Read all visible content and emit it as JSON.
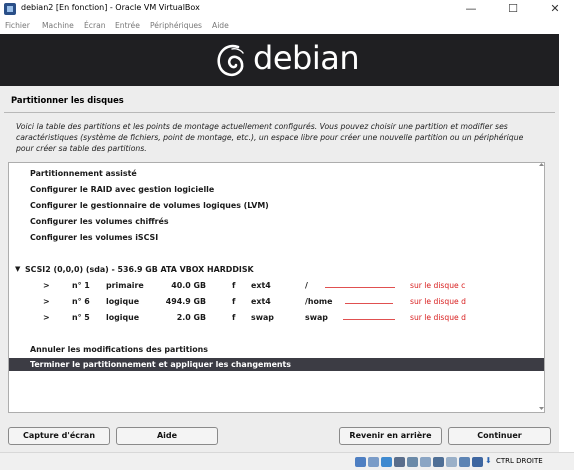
{
  "window": {
    "title": "debian2 [En fonction] - Oracle VM VirtualBox",
    "minimize_glyph": "—",
    "maximize_glyph": "☐",
    "close_glyph": "✕"
  },
  "menubar": [
    "Fichier",
    "Machine",
    "Écran",
    "Entrée",
    "Périphériques",
    "Aide"
  ],
  "banner": {
    "brand": "debian"
  },
  "installer": {
    "step_title": "Partitionner les disques",
    "description": "Voici la table des partitions et les points de montage actuellement configurés. Vous pouvez choisir une partition et modifier ses caractéristiques (système de fichiers, point de montage, etc.), un espace libre pour créer une nouvelle partition ou un périphérique pour créer sa table des partitions.",
    "menu_items": [
      "Partitionnement assisté",
      "Configurer le RAID avec gestion logicielle",
      "Configurer le gestionnaire de volumes logiques (LVM)",
      "Configurer les volumes chiffrés",
      "Configurer les volumes iSCSI"
    ],
    "disk": {
      "caret": "▼",
      "label": "SCSI2 (0,0,0) (sda) - 536.9 GB ATA VBOX HARDDISK"
    },
    "partitions": [
      {
        "arrow": ">",
        "number": "n° 1",
        "type": "primaire",
        "size": "40.0 GB",
        "flag": "f",
        "fs": "ext4",
        "mount": "/",
        "annotation": "sur le disque c"
      },
      {
        "arrow": ">",
        "number": "n° 6",
        "type": "logique",
        "size": "494.9 GB",
        "flag": "f",
        "fs": "ext4",
        "mount": "/home",
        "annotation": "sur le disque d"
      },
      {
        "arrow": ">",
        "number": "n° 5",
        "type": "logique",
        "size": "2.0 GB",
        "flag": "f",
        "fs": "swap",
        "mount": "swap",
        "annotation": "sur le disque d"
      }
    ],
    "undo_label": "Annuler les modifications des partitions",
    "finish_label": "Terminer le partitionnement et appliquer les changements"
  },
  "buttons": {
    "screenshot": "Capture d'écran",
    "help": "Aide",
    "back": "Revenir en arrière",
    "continue": "Continuer"
  },
  "status": {
    "host_key": "CTRL DROITE"
  }
}
